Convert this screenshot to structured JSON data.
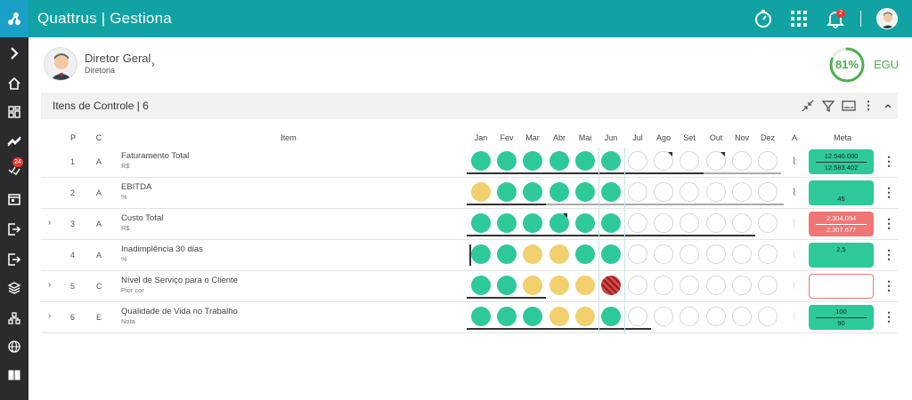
{
  "app": {
    "brand": "Quattrus | Gestiona"
  },
  "topbar": {
    "notifications_badge": "2"
  },
  "sidebar": {
    "badge": "24"
  },
  "user": {
    "name": "Diretor Geral",
    "role": "Diretoria"
  },
  "egu": {
    "value": "81%",
    "label": "EGU",
    "percent": 81
  },
  "panel": {
    "title": "Itens de Controle | 6"
  },
  "table": {
    "headers": {
      "p": "P",
      "c": "C",
      "item": "Item",
      "a": "A",
      "meta": "Meta"
    },
    "months": [
      "Jan",
      "Fev",
      "Mar",
      "Abr",
      "Mai",
      "Jun",
      "Jul",
      "Ago",
      "Set",
      "Out",
      "Nov",
      "Dez"
    ],
    "rows": [
      {
        "p": "1",
        "c": "A",
        "name": "Faturamento Total",
        "unit": "R$",
        "expandable": false,
        "status": [
          "green",
          "green",
          "green",
          "green",
          "green",
          "green",
          "empty",
          "empty",
          "empty",
          "empty",
          "empty",
          "empty"
        ],
        "flagged": [
          7,
          9
        ],
        "attach": true,
        "meta": {
          "style": "green",
          "line1": "12.540.000",
          "line2": "12.583.402"
        }
      },
      {
        "p": "2",
        "c": "A",
        "name": "EBITDA",
        "unit": "%",
        "expandable": false,
        "status": [
          "yellow",
          "green",
          "green",
          "green",
          "green",
          "green",
          "empty",
          "empty",
          "empty",
          "empty",
          "empty",
          "empty"
        ],
        "flagged": [],
        "attach": true,
        "meta": {
          "style": "green",
          "line1": "",
          "line2": "45"
        }
      },
      {
        "p": "3",
        "c": "A",
        "name": "Custo Total",
        "unit": "R$",
        "expandable": true,
        "status": [
          "green",
          "green",
          "green",
          "green",
          "green",
          "green",
          "empty",
          "empty",
          "empty",
          "empty",
          "empty",
          "empty"
        ],
        "flagged": [
          3
        ],
        "attach": false,
        "meta": {
          "style": "red",
          "line1": "2.304.054",
          "line2": "2.307.677"
        }
      },
      {
        "p": "4",
        "c": "A",
        "name": "Inadimplência 30 dias",
        "unit": "%",
        "expandable": false,
        "status": [
          "green",
          "green",
          "yellow",
          "yellow",
          "green",
          "green",
          "empty",
          "empty",
          "empty",
          "empty",
          "empty",
          "empty"
        ],
        "flagged": [],
        "attach": false,
        "meta": {
          "style": "green",
          "line1": "2,5",
          "line2": ""
        }
      },
      {
        "p": "5",
        "c": "C",
        "name": "Nível de Serviço para o Cliente",
        "unit": "Pior cor",
        "expandable": true,
        "status": [
          "green",
          "green",
          "yellow",
          "yellow",
          "yellow",
          "red",
          "empty",
          "empty",
          "empty",
          "empty",
          "empty",
          "empty"
        ],
        "flagged": [],
        "attach": false,
        "meta": {
          "style": "white",
          "line1": "",
          "line2": ""
        }
      },
      {
        "p": "6",
        "c": "E",
        "name": "Qualidade de Vida no Trabalho",
        "unit": "Nota",
        "expandable": true,
        "status": [
          "green",
          "green",
          "green",
          "yellow",
          "yellow",
          "green",
          "empty",
          "empty",
          "empty",
          "empty",
          "empty",
          "empty"
        ],
        "flagged": [],
        "attach": false,
        "meta": {
          "style": "green",
          "line1": "100",
          "line2": "90"
        }
      }
    ]
  }
}
